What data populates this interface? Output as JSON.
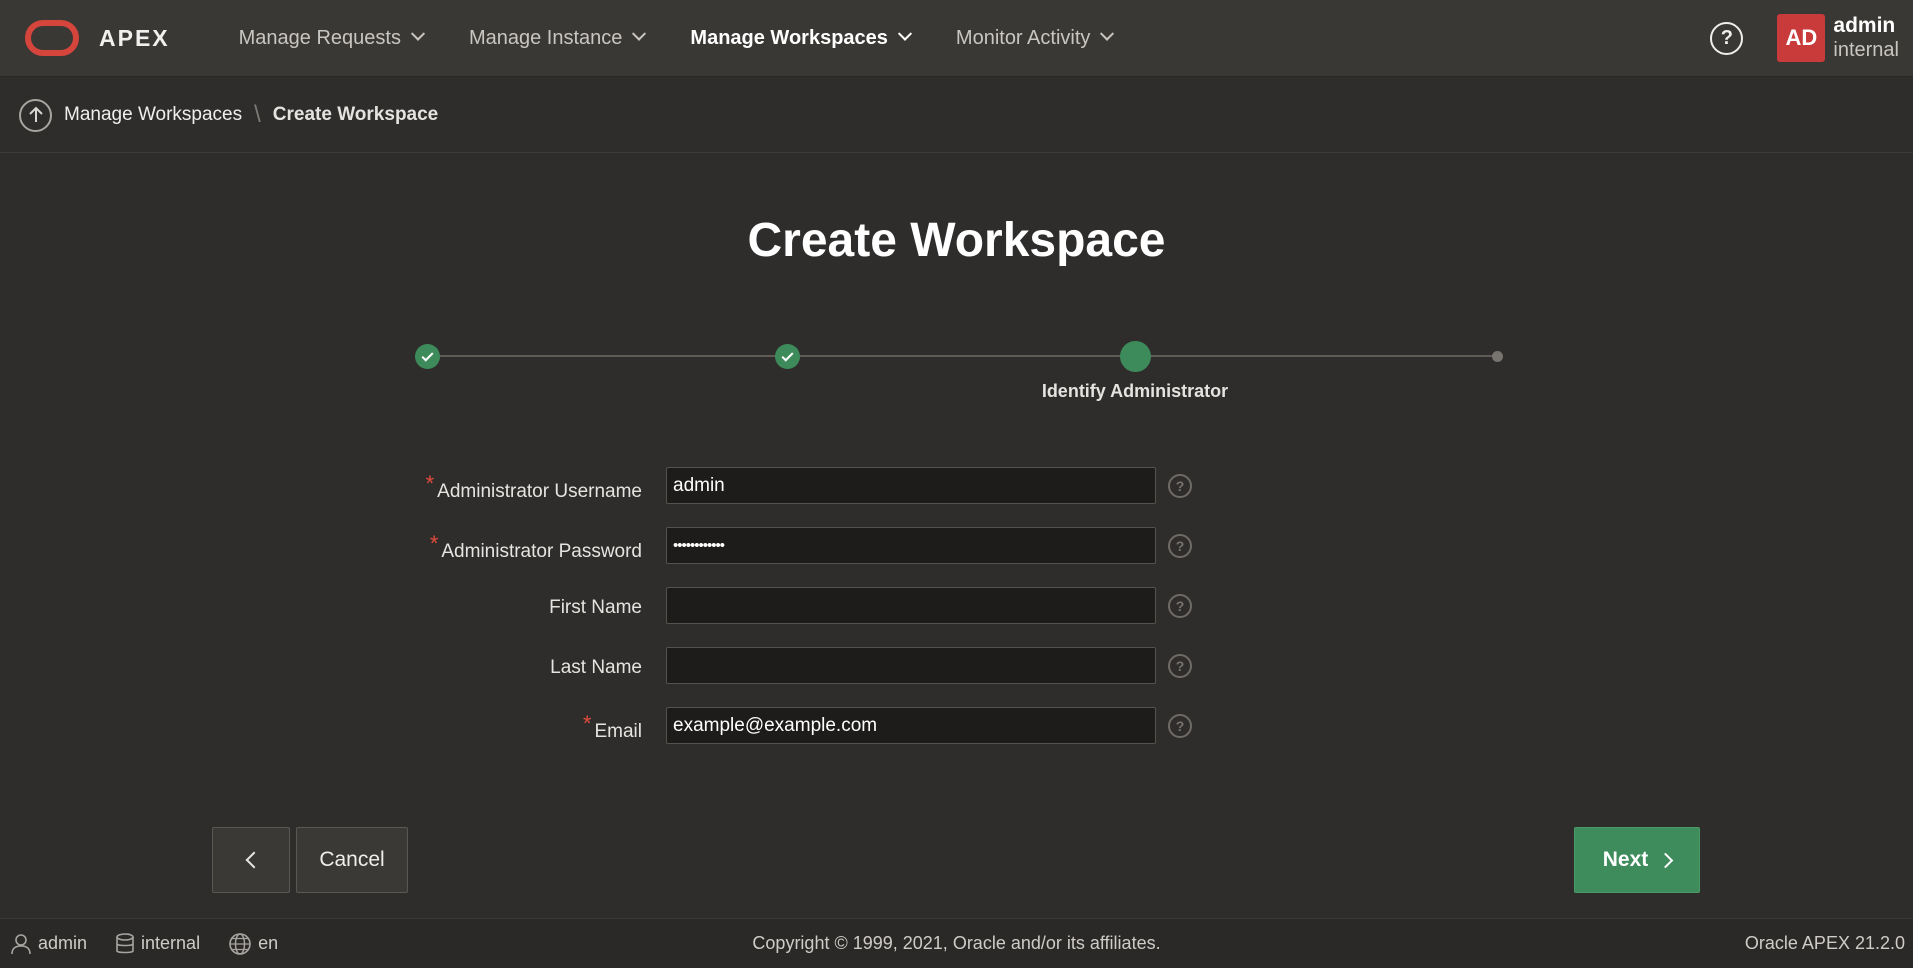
{
  "app": {
    "logo_text": "APEX",
    "colors": {
      "brand_red": "#d6453b",
      "accent_green": "#3d8b5a",
      "avatar_red": "#c93a3a"
    }
  },
  "nav": {
    "items": [
      {
        "label": "Manage Requests",
        "active": false
      },
      {
        "label": "Manage Instance",
        "active": false
      },
      {
        "label": "Manage Workspaces",
        "active": true
      },
      {
        "label": "Monitor Activity",
        "active": false
      }
    ],
    "help_glyph": "?",
    "avatar_initials": "AD",
    "user_name": "admin",
    "user_workspace": "internal"
  },
  "breadcrumb": {
    "parent": "Manage Workspaces",
    "separator": "\\",
    "current": "Create Workspace"
  },
  "page": {
    "title": "Create Workspace"
  },
  "wizard": {
    "steps": [
      {
        "state": "done"
      },
      {
        "state": "done"
      },
      {
        "state": "current",
        "label": "Identify Administrator"
      },
      {
        "state": "future"
      }
    ]
  },
  "form": {
    "fields": [
      {
        "label": "Administrator Username",
        "required": true,
        "value": "admin"
      },
      {
        "label": "Administrator Password",
        "required": true,
        "value": "••••••••••••"
      },
      {
        "label": "First Name",
        "required": false,
        "value": ""
      },
      {
        "label": "Last Name",
        "required": false,
        "value": ""
      },
      {
        "label": "Email",
        "required": true,
        "value": "example@example.com"
      }
    ],
    "required_marker": "*",
    "help_glyph": "?"
  },
  "buttons": {
    "cancel": "Cancel",
    "next": "Next"
  },
  "footer": {
    "user": "admin",
    "workspace": "internal",
    "language": "en",
    "copyright": "Copyright © 1999, 2021, Oracle and/or its affiliates.",
    "version": "Oracle APEX 21.2.0"
  }
}
